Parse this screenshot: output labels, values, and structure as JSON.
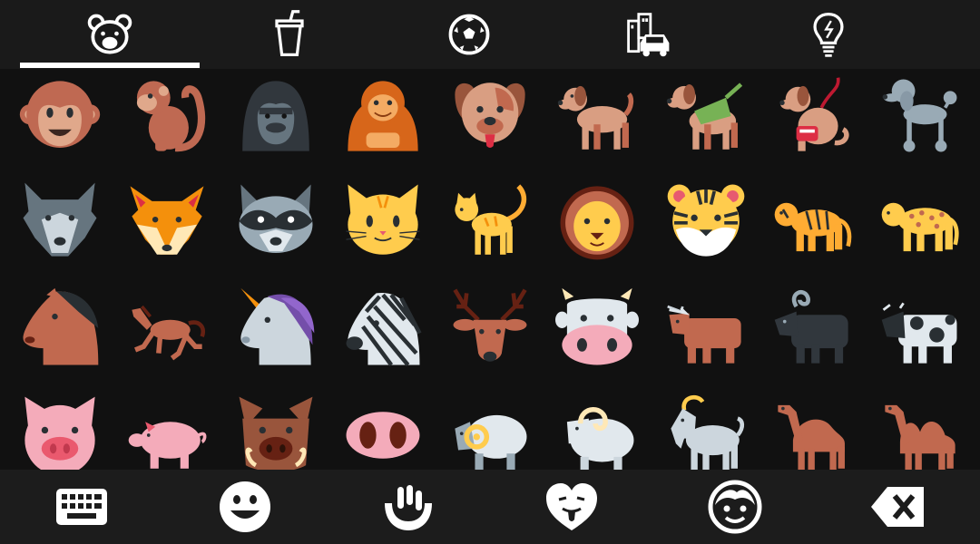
{
  "category_tabs": [
    {
      "icon": "bear-face-icon",
      "selected": true
    },
    {
      "icon": "drink-cup-icon",
      "selected": false
    },
    {
      "icon": "soccer-ball-icon",
      "selected": false
    },
    {
      "icon": "buildings-car-icon",
      "selected": false
    },
    {
      "icon": "light-bulb-icon",
      "selected": false
    }
  ],
  "emoji_grid": [
    [
      "monkey-face",
      "monkey",
      "gorilla",
      "orangutan",
      "dog-face",
      "dog",
      "guide-dog",
      "service-dog",
      "poodle"
    ],
    [
      "wolf",
      "fox",
      "raccoon",
      "cat-face",
      "cat",
      "lion",
      "tiger-face",
      "tiger",
      "leopard"
    ],
    [
      "horse-face",
      "racehorse",
      "unicorn",
      "zebra",
      "deer",
      "cow-face",
      "ox",
      "water-buffalo",
      "cow"
    ],
    [
      "pig-face",
      "pig",
      "boar",
      "pig-nose",
      "ram",
      "ewe",
      "goat",
      "camel",
      "two-hump-camel"
    ]
  ],
  "bottom_bar": [
    {
      "icon": "keyboard-icon"
    },
    {
      "icon": "smiley-icon"
    },
    {
      "icon": "hand-gesture-icon"
    },
    {
      "icon": "heart-face-icon"
    },
    {
      "icon": "face-outline-icon"
    },
    {
      "icon": "backspace-icon"
    }
  ],
  "colors": {
    "background": "#111111",
    "top_bar": "#1a1a1a",
    "bottom_bar": "#1c1c1c",
    "icon": "#ffffff"
  }
}
